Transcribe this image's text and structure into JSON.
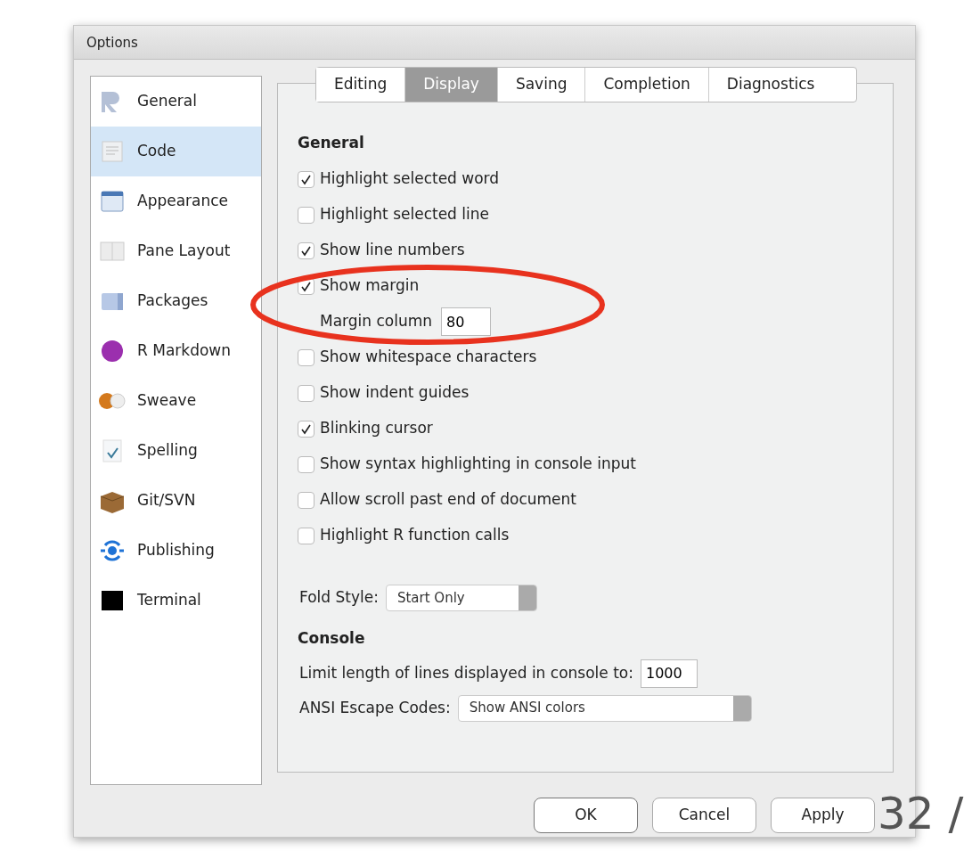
{
  "window": {
    "title": "Options"
  },
  "sidebar": {
    "items": [
      {
        "label": "General",
        "selected": false
      },
      {
        "label": "Code",
        "selected": true
      },
      {
        "label": "Appearance",
        "selected": false
      },
      {
        "label": "Pane Layout",
        "selected": false
      },
      {
        "label": "Packages",
        "selected": false
      },
      {
        "label": "R Markdown",
        "selected": false
      },
      {
        "label": "Sweave",
        "selected": false
      },
      {
        "label": "Spelling",
        "selected": false
      },
      {
        "label": "Git/SVN",
        "selected": false
      },
      {
        "label": "Publishing",
        "selected": false
      },
      {
        "label": "Terminal",
        "selected": false
      }
    ]
  },
  "tabs": [
    {
      "label": "Editing",
      "selected": false
    },
    {
      "label": "Display",
      "selected": true
    },
    {
      "label": "Saving",
      "selected": false
    },
    {
      "label": "Completion",
      "selected": false
    },
    {
      "label": "Diagnostics",
      "selected": false
    }
  ],
  "general": {
    "heading": "General",
    "options": [
      {
        "kind": "checkbox",
        "label": "Highlight selected word",
        "checked": true
      },
      {
        "kind": "checkbox",
        "label": "Highlight selected line",
        "checked": false
      },
      {
        "kind": "checkbox",
        "label": "Show line numbers",
        "checked": true
      },
      {
        "kind": "checkbox",
        "label": "Show margin",
        "checked": true
      },
      {
        "kind": "number",
        "label": "Margin column",
        "value": "80"
      },
      {
        "kind": "checkbox",
        "label": "Show whitespace characters",
        "checked": false
      },
      {
        "kind": "checkbox",
        "label": "Show indent guides",
        "checked": false
      },
      {
        "kind": "checkbox",
        "label": "Blinking cursor",
        "checked": true
      },
      {
        "kind": "checkbox",
        "label": "Show syntax highlighting in console input",
        "checked": false
      },
      {
        "kind": "checkbox",
        "label": "Allow scroll past end of document",
        "checked": false
      },
      {
        "kind": "checkbox",
        "label": "Highlight R function calls",
        "checked": false
      }
    ],
    "fold_style": {
      "label": "Fold Style:",
      "value": "Start Only"
    }
  },
  "console": {
    "heading": "Console",
    "limit": {
      "label": "Limit length of lines displayed in console to:",
      "value": "1000"
    },
    "ansi": {
      "label": "ANSI Escape Codes:",
      "value": "Show ANSI colors"
    }
  },
  "buttons": [
    "OK",
    "Cancel",
    "Apply"
  ],
  "slide_number": "32 /"
}
